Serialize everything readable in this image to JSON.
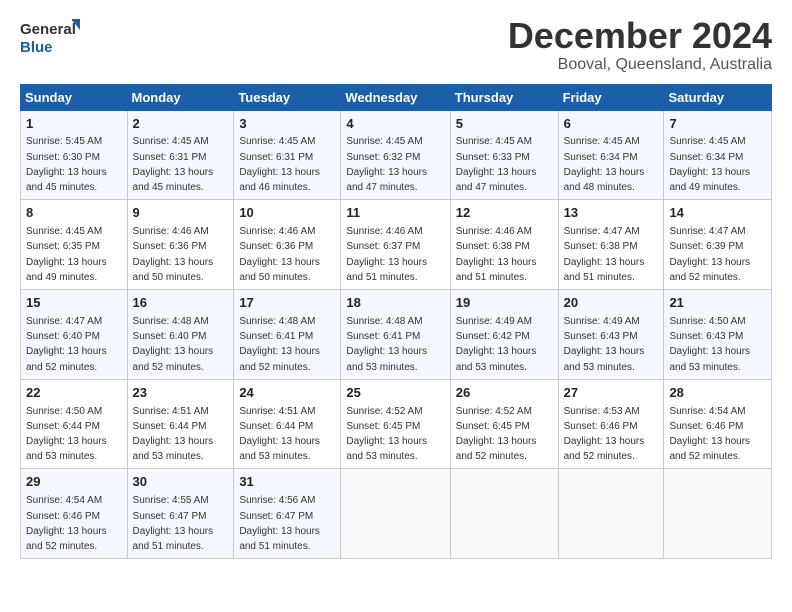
{
  "header": {
    "logo_line1": "General",
    "logo_line2": "Blue",
    "title": "December 2024",
    "subtitle": "Booval, Queensland, Australia"
  },
  "days_of_week": [
    "Sunday",
    "Monday",
    "Tuesday",
    "Wednesday",
    "Thursday",
    "Friday",
    "Saturday"
  ],
  "weeks": [
    [
      {
        "day": "1",
        "sunrise": "5:45 AM",
        "sunset": "6:30 PM",
        "hours": "13",
        "minutes": "45"
      },
      {
        "day": "2",
        "sunrise": "4:45 AM",
        "sunset": "6:31 PM",
        "hours": "13",
        "minutes": "45"
      },
      {
        "day": "3",
        "sunrise": "4:45 AM",
        "sunset": "6:31 PM",
        "hours": "13",
        "minutes": "46"
      },
      {
        "day": "4",
        "sunrise": "4:45 AM",
        "sunset": "6:32 PM",
        "hours": "13",
        "minutes": "47"
      },
      {
        "day": "5",
        "sunrise": "4:45 AM",
        "sunset": "6:33 PM",
        "hours": "13",
        "minutes": "47"
      },
      {
        "day": "6",
        "sunrise": "4:45 AM",
        "sunset": "6:34 PM",
        "hours": "13",
        "minutes": "48"
      },
      {
        "day": "7",
        "sunrise": "4:45 AM",
        "sunset": "6:34 PM",
        "hours": "13",
        "minutes": "49"
      }
    ],
    [
      {
        "day": "8",
        "sunrise": "4:45 AM",
        "sunset": "6:35 PM",
        "hours": "13",
        "minutes": "49"
      },
      {
        "day": "9",
        "sunrise": "4:46 AM",
        "sunset": "6:36 PM",
        "hours": "13",
        "minutes": "50"
      },
      {
        "day": "10",
        "sunrise": "4:46 AM",
        "sunset": "6:36 PM",
        "hours": "13",
        "minutes": "50"
      },
      {
        "day": "11",
        "sunrise": "4:46 AM",
        "sunset": "6:37 PM",
        "hours": "13",
        "minutes": "51"
      },
      {
        "day": "12",
        "sunrise": "4:46 AM",
        "sunset": "6:38 PM",
        "hours": "13",
        "minutes": "51"
      },
      {
        "day": "13",
        "sunrise": "4:47 AM",
        "sunset": "6:38 PM",
        "hours": "13",
        "minutes": "51"
      },
      {
        "day": "14",
        "sunrise": "4:47 AM",
        "sunset": "6:39 PM",
        "hours": "13",
        "minutes": "52"
      }
    ],
    [
      {
        "day": "15",
        "sunrise": "4:47 AM",
        "sunset": "6:40 PM",
        "hours": "13",
        "minutes": "52"
      },
      {
        "day": "16",
        "sunrise": "4:48 AM",
        "sunset": "6:40 PM",
        "hours": "13",
        "minutes": "52"
      },
      {
        "day": "17",
        "sunrise": "4:48 AM",
        "sunset": "6:41 PM",
        "hours": "13",
        "minutes": "52"
      },
      {
        "day": "18",
        "sunrise": "4:48 AM",
        "sunset": "6:41 PM",
        "hours": "13",
        "minutes": "53"
      },
      {
        "day": "19",
        "sunrise": "4:49 AM",
        "sunset": "6:42 PM",
        "hours": "13",
        "minutes": "53"
      },
      {
        "day": "20",
        "sunrise": "4:49 AM",
        "sunset": "6:43 PM",
        "hours": "13",
        "minutes": "53"
      },
      {
        "day": "21",
        "sunrise": "4:50 AM",
        "sunset": "6:43 PM",
        "hours": "13",
        "minutes": "53"
      }
    ],
    [
      {
        "day": "22",
        "sunrise": "4:50 AM",
        "sunset": "6:44 PM",
        "hours": "13",
        "minutes": "53"
      },
      {
        "day": "23",
        "sunrise": "4:51 AM",
        "sunset": "6:44 PM",
        "hours": "13",
        "minutes": "53"
      },
      {
        "day": "24",
        "sunrise": "4:51 AM",
        "sunset": "6:44 PM",
        "hours": "13",
        "minutes": "53"
      },
      {
        "day": "25",
        "sunrise": "4:52 AM",
        "sunset": "6:45 PM",
        "hours": "13",
        "minutes": "53"
      },
      {
        "day": "26",
        "sunrise": "4:52 AM",
        "sunset": "6:45 PM",
        "hours": "13",
        "minutes": "52"
      },
      {
        "day": "27",
        "sunrise": "4:53 AM",
        "sunset": "6:46 PM",
        "hours": "13",
        "minutes": "52"
      },
      {
        "day": "28",
        "sunrise": "4:54 AM",
        "sunset": "6:46 PM",
        "hours": "13",
        "minutes": "52"
      }
    ],
    [
      {
        "day": "29",
        "sunrise": "4:54 AM",
        "sunset": "6:46 PM",
        "hours": "13",
        "minutes": "52"
      },
      {
        "day": "30",
        "sunrise": "4:55 AM",
        "sunset": "6:47 PM",
        "hours": "13",
        "minutes": "51"
      },
      {
        "day": "31",
        "sunrise": "4:56 AM",
        "sunset": "6:47 PM",
        "hours": "13",
        "minutes": "51"
      },
      null,
      null,
      null,
      null
    ]
  ]
}
